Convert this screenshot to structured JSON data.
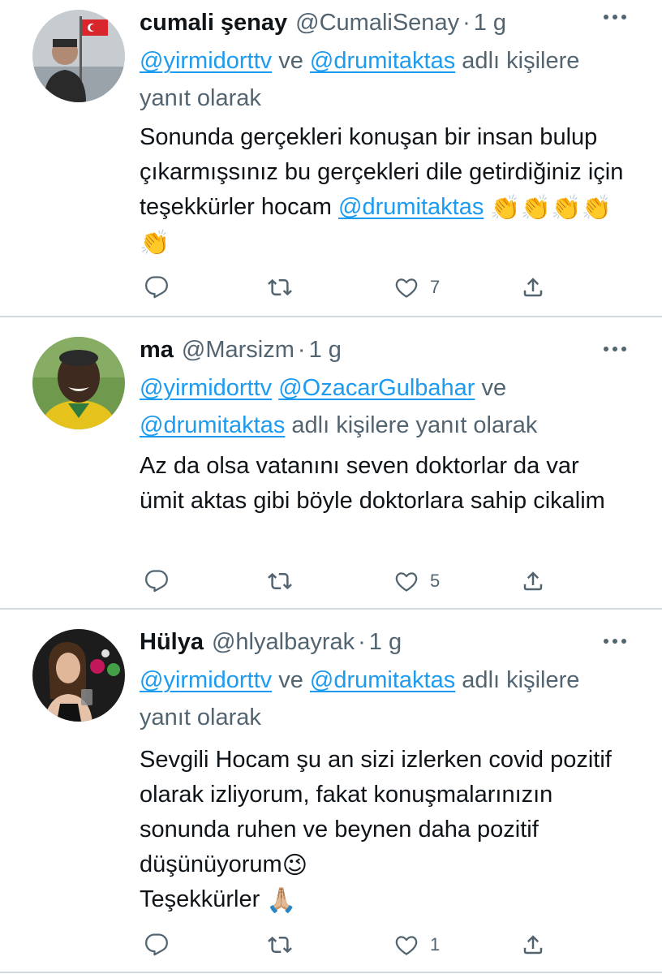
{
  "tweets": [
    {
      "name": "cumali şenay",
      "handle": "@CumaliSenay",
      "separator": "·",
      "time": "1 g",
      "reply_mentions": [
        "@yirmidorttv",
        "@drumitaktas"
      ],
      "reply_joiner": " ve ",
      "reply_suffix": " adlı kişilere yanıt olarak",
      "body_text": "Sonunda gerçekleri konuşan bir insan bulup çıkarmışsınız bu gerçekleri dile getirdiğiniz için teşekkürler hocam",
      "body_mention": "@drumitaktas",
      "body_emoji": "👏👏👏👏👏",
      "like_count": "7",
      "avatar_icon": "profile-photo-man-with-flag"
    },
    {
      "name": "ma",
      "handle": "@Marsizm",
      "separator": "·",
      "time": "1 g",
      "reply_mentions": [
        "@yirmidorttv",
        "@OzacarGulbahar",
        "@drumitaktas"
      ],
      "reply_joiner": " ve ",
      "reply_suffix": " adlı kişilere yanıt olarak",
      "body_text": "Az da olsa vatanını seven  doktorlar da var ümit aktas gibi böyle doktorlara sahip cikalim",
      "like_count": "5",
      "avatar_icon": "profile-photo-smiling-man"
    },
    {
      "name": "Hülya",
      "handle": "@hlyalbayrak",
      "separator": "·",
      "time": "1 g",
      "reply_mentions": [
        "@yirmidorttv",
        "@drumitaktas"
      ],
      "reply_joiner": " ve ",
      "reply_suffix": " adlı kişilere yanıt olarak",
      "body_text": "Sevgili Hocam şu an sizi izlerken covid pozitif olarak izliyorum, fakat konuşmalarınızın sonunda ruhen ve beynen daha pozitif düşünüyorum",
      "body_emoji_1": "😉",
      "body_text_2": "Teşekkürler",
      "body_emoji_2": "🙏🏼",
      "like_count": "1",
      "avatar_icon": "profile-photo-woman"
    }
  ],
  "icons": {
    "reply": "reply-icon",
    "retweet": "retweet-icon",
    "like": "like-icon",
    "share": "share-icon",
    "more": "more-options-icon"
  },
  "colors": {
    "link": "#1d9bf0",
    "secondary_text": "#536471",
    "primary_text": "#0f1419",
    "divider": "#cfd9de"
  }
}
